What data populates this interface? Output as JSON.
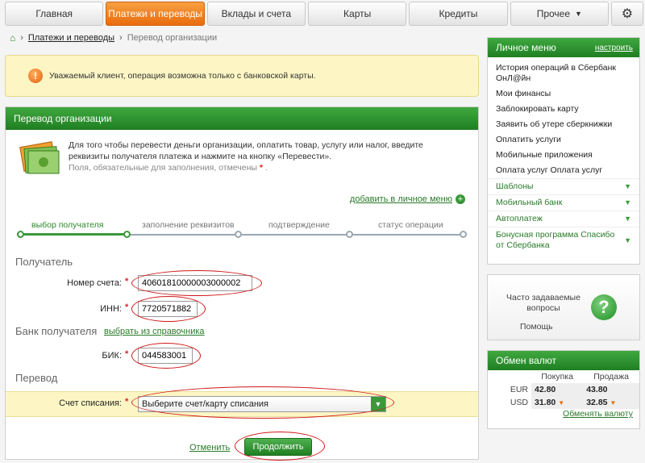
{
  "nav": {
    "tabs": [
      {
        "label": "Главная"
      },
      {
        "label": "Платежи и переводы"
      },
      {
        "label": "Вклады и счета"
      },
      {
        "label": "Карты"
      },
      {
        "label": "Кредиты"
      },
      {
        "label": "Прочее"
      }
    ]
  },
  "breadcrumb": {
    "link": "Платежи и переводы",
    "current": "Перевод организации"
  },
  "alert": {
    "text": "Уважаемый клиент, операция возможна только с банковской карты."
  },
  "form": {
    "title": "Перевод организации",
    "intro": "Для того чтобы перевести деньги организации, оплатить товар, услугу или налог, введите реквизиты получателя платежа и нажмите на кнопку «Перевести».",
    "required_note": "Поля, обязательные для заполнения, отмечены",
    "add_to_menu": "добавить в личное меню",
    "steps": [
      "выбор получателя",
      "заполнение реквизитов",
      "подтверждение",
      "статус операции"
    ],
    "recipient_section": "Получатель",
    "account_label": "Номер счета:",
    "account_value": "40601810000003000002",
    "inn_label": "ИНН:",
    "inn_value": "7720571882",
    "bank_section": "Банк получателя",
    "bank_directory_link": "выбрать из справочника",
    "bik_label": "БИК:",
    "bik_value": "044583001",
    "transfer_section": "Перевод",
    "debit_label": "Счет списания:",
    "debit_placeholder": "Выберите счет/карту списания",
    "cancel": "Отменить",
    "continue": "Продолжить"
  },
  "personal_menu": {
    "title": "Личное меню",
    "configure": "настроить",
    "items": [
      "История операций в Сбербанк ОнЛ@йн",
      "Мои финансы",
      "Заблокировать карту",
      "Заявить об утере сберкнижки",
      "Оплатить услуги",
      "Мобильные приложения",
      "Оплата услуг Оплата услуг"
    ],
    "groups": [
      "Шаблоны",
      "Мобильный банк",
      "Автоплатеж",
      "Бонусная программа Спасибо от Сбербанка"
    ]
  },
  "faq": {
    "question": "Часто задаваемые вопросы",
    "help": "Помощь"
  },
  "fx": {
    "title": "Обмен валют",
    "buy": "Покупка",
    "sell": "Продажа",
    "rows": [
      {
        "cur": "EUR",
        "buy": "42.80",
        "sell": "43.80"
      },
      {
        "cur": "USD",
        "buy": "31.80",
        "sell": "32.85"
      }
    ],
    "link": "Обменять валюту"
  }
}
